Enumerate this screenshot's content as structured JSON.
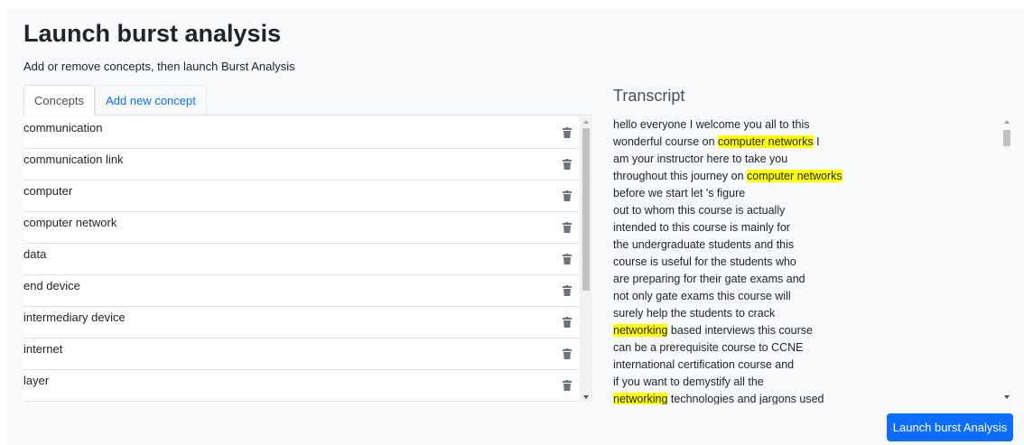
{
  "page": {
    "title": "Launch burst analysis",
    "subtitle": "Add or remove concepts, then launch Burst Analysis"
  },
  "tabs": [
    {
      "label": "Concepts",
      "active": true
    },
    {
      "label": "Add new concept",
      "active": false
    }
  ],
  "concepts": [
    {
      "label": "communication"
    },
    {
      "label": "communication link"
    },
    {
      "label": "computer"
    },
    {
      "label": "computer network"
    },
    {
      "label": "data"
    },
    {
      "label": "end device"
    },
    {
      "label": "intermediary device"
    },
    {
      "label": "internet"
    },
    {
      "label": "layer"
    }
  ],
  "transcript": {
    "title": "Transcript",
    "lines": [
      [
        {
          "text": "hello everyone I welcome you all to this"
        }
      ],
      [
        {
          "text": "wonderful course on "
        },
        {
          "text": "computer networks",
          "hl": true
        },
        {
          "text": " I"
        }
      ],
      [
        {
          "text": "am your instructor here to take you"
        }
      ],
      [
        {
          "text": "throughout this journey on "
        },
        {
          "text": "computer networks",
          "hl": true
        }
      ],
      [
        {
          "text": "before we start let 's figure"
        }
      ],
      [
        {
          "text": "out to whom this course is actually"
        }
      ],
      [
        {
          "text": "intended to this course is mainly for"
        }
      ],
      [
        {
          "text": "the undergraduate students and this"
        }
      ],
      [
        {
          "text": "course is useful for the students who"
        }
      ],
      [
        {
          "text": "are preparing for their gate exams and"
        }
      ],
      [
        {
          "text": "not only gate exams this course will"
        }
      ],
      [
        {
          "text": "surely help the students to crack"
        }
      ],
      [
        {
          "text": "networking",
          "hl": true
        },
        {
          "text": " based interviews this course"
        }
      ],
      [
        {
          "text": "can be a prerequisite course to CCNE"
        }
      ],
      [
        {
          "text": "international certification course and"
        }
      ],
      [
        {
          "text": "if you want to demystify all the"
        }
      ],
      [
        {
          "text": "networking",
          "hl": true
        },
        {
          "text": " technologies and jargons used"
        }
      ]
    ]
  },
  "actions": {
    "launch_label": "Launch burst Analysis"
  },
  "colors": {
    "highlight": "#ffff00",
    "primary": "#0d6efd"
  },
  "icons": {
    "delete": "trash-icon"
  }
}
